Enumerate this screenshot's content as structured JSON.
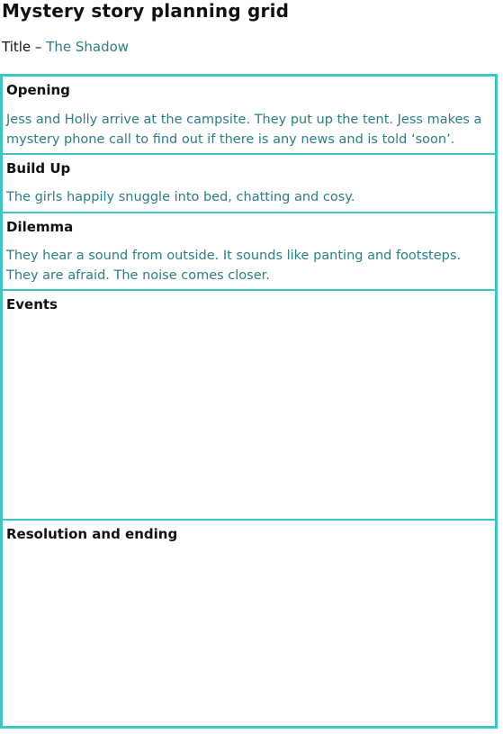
{
  "document": {
    "title": "Mystery story planning grid",
    "title_label": "Title –",
    "story_title": "The Shadow"
  },
  "grid": {
    "sections": [
      {
        "heading": "Opening",
        "text": "Jess and Holly arrive at the campsite.  They put up the tent.  Jess makes a mystery phone call to find out if there is any news and is told ‘soon’."
      },
      {
        "heading": "Build Up",
        "text": "The girls happily snuggle into bed, chatting and cosy."
      },
      {
        "heading": "Dilemma",
        "text": "They hear a sound from outside.  It sounds like panting and footsteps.  They are afraid.  The noise comes closer."
      },
      {
        "heading": "Events",
        "text": ""
      },
      {
        "heading": "Resolution and ending",
        "text": ""
      }
    ]
  },
  "colors": {
    "border": "#3cc7c7",
    "body_text": "#2a7f86",
    "heading_text": "#111111"
  }
}
